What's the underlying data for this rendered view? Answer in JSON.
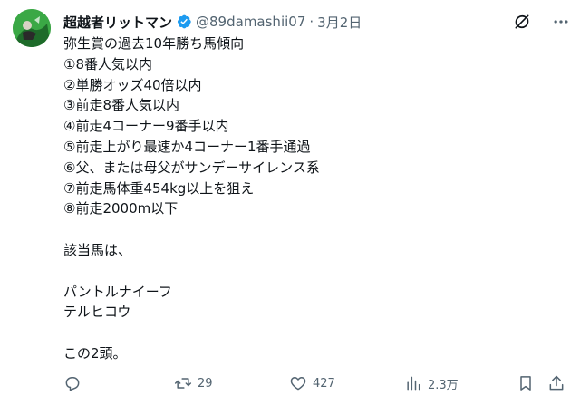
{
  "tweet": {
    "display_name": "超越者リットマン",
    "handle": "@89damashii07",
    "separator": "·",
    "date": "3月2日",
    "lines": [
      "弥生賞の過去10年勝ち馬傾向",
      "①8番人気以内",
      "②単勝オッズ40倍以内",
      "③前走8番人気以内",
      "④前走4コーナー9番手以内",
      "⑤前走上がり最速か4コーナー1番手通過",
      "⑥父、または母父がサンデーサイレンス系",
      "⑦前走馬体重454kg以上を狙え",
      "⑧前走2000m以下",
      "",
      "該当馬は、",
      "",
      "パントルナイーフ",
      "テルヒコウ",
      "",
      "この2頭。"
    ]
  },
  "actions": {
    "retweets": "29",
    "likes": "427",
    "views": "2.3万"
  },
  "colors": {
    "text": "#0f1419",
    "secondary": "#536471",
    "verified": "#1d9bf0"
  }
}
